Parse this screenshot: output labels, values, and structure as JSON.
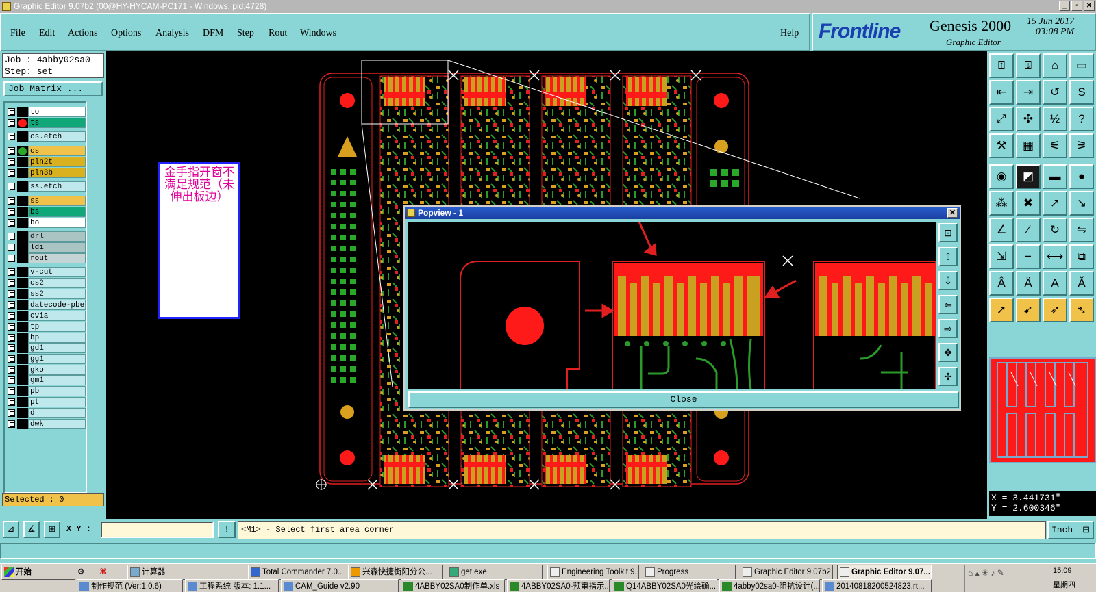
{
  "window": {
    "title": "Graphic Editor 9.07b2 (00@HY-HYCAM-PC171 - Windows, pid:4728)",
    "controls": [
      "_",
      "▫",
      "✕"
    ]
  },
  "menu": {
    "items": [
      "File",
      "Edit",
      "Actions",
      "Options",
      "Analysis",
      "DFM",
      "Step",
      "Rout",
      "Windows"
    ],
    "help": "Help"
  },
  "logo": {
    "brand": "Frontline",
    "product": "Genesis 2000",
    "subtitle": "Graphic Editor",
    "date": "15 Jun 2017",
    "time": "03:08 PM"
  },
  "job": {
    "job_line": "Job : 4abby02sa0",
    "step_line": "Step: set",
    "matrix_button": "Job Matrix ..."
  },
  "layers": [
    {
      "name": "to",
      "color": "#ffffff",
      "dot": ""
    },
    {
      "name": "ts",
      "color": "#10a878",
      "dot": "#ff1a1a"
    },
    {
      "name": "cs.etch",
      "color": "#bfe8ec",
      "dot": ""
    },
    {
      "name": "cs",
      "color": "#f0c24a",
      "dot": "#2aa82a"
    },
    {
      "name": "pln2t",
      "color": "#d9b01e",
      "dot": ""
    },
    {
      "name": "pln3b",
      "color": "#d9b01e",
      "dot": ""
    },
    {
      "name": "ss.etch",
      "color": "#bfe8ec",
      "dot": ""
    },
    {
      "name": "ss",
      "color": "#f0c24a",
      "dot": ""
    },
    {
      "name": "bs",
      "color": "#10a878",
      "dot": ""
    },
    {
      "name": "bo",
      "color": "#ffffff",
      "dot": ""
    },
    {
      "name": "drl",
      "color": "#aac4c4",
      "dot": ""
    },
    {
      "name": "ldi",
      "color": "#aac4c4",
      "dot": ""
    },
    {
      "name": "rout",
      "color": "#c4d4d4",
      "dot": ""
    },
    {
      "name": "v-cut",
      "color": "#bfe8ec",
      "dot": ""
    },
    {
      "name": "cs2",
      "color": "#bfe8ec",
      "dot": ""
    },
    {
      "name": "ss2",
      "color": "#bfe8ec",
      "dot": ""
    },
    {
      "name": "datecode-pbe",
      "color": "#bfe8ec",
      "dot": ""
    },
    {
      "name": "cvia",
      "color": "#bfe8ec",
      "dot": ""
    },
    {
      "name": "tp",
      "color": "#bfe8ec",
      "dot": ""
    },
    {
      "name": "bp",
      "color": "#bfe8ec",
      "dot": ""
    },
    {
      "name": "gd1",
      "color": "#bfe8ec",
      "dot": ""
    },
    {
      "name": "gg1",
      "color": "#bfe8ec",
      "dot": ""
    },
    {
      "name": "gko",
      "color": "#bfe8ec",
      "dot": ""
    },
    {
      "name": "gm1",
      "color": "#bfe8ec",
      "dot": ""
    },
    {
      "name": "pb",
      "color": "#bfe8ec",
      "dot": ""
    },
    {
      "name": "pt",
      "color": "#bfe8ec",
      "dot": ""
    },
    {
      "name": "d",
      "color": "#bfe8ec",
      "dot": ""
    },
    {
      "name": "dwk",
      "color": "#bfe8ec",
      "dot": ""
    }
  ],
  "selected": "Selected : 0",
  "note": "金手指开窗不满足规范（未伸出板边）",
  "popview": {
    "title": "Popview - 1",
    "close_label": "Close"
  },
  "coords": {
    "x": "X = 3.441731\"",
    "y": "Y = 2.600346\""
  },
  "command": {
    "xy_label": "X Y :",
    "xy_value": "",
    "message": "<M1> - Select first area corner",
    "units": "Inch"
  },
  "taskbar": {
    "start": "开始",
    "row1": [
      "计算器",
      "Total Commander 7.0...",
      "兴森快捷衡阳分公...",
      "get.exe",
      "Engineering Toolkit 9....",
      "Progress",
      "Graphic Editor 9.07b2...",
      "Graphic Editor 9.07..."
    ],
    "row2": [
      "制作规范 (Ver:1.0.6)",
      "工程系统   版本: 1.1...",
      "CAM_Guide v2.90",
      "4ABBY02SA0制作单.xls",
      "4ABBY02SA0-预审指示...",
      "Q14ABBY02SA0光绘确...",
      "4abby02sa0-阻抗设计(...",
      "20140818200524823.rt..."
    ],
    "clock": "15:09",
    "day": "星期四"
  }
}
